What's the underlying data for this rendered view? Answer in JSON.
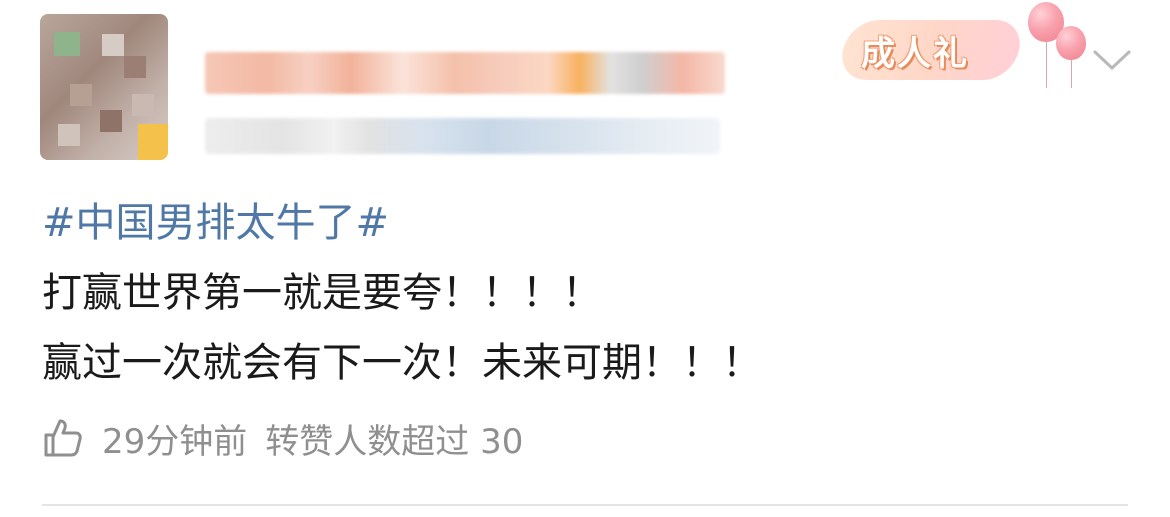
{
  "badge": {
    "label": "成人礼",
    "colors": {
      "background": "#ffd7c8",
      "text_outline": "#e88b5b",
      "balloon": "#f9a1ad"
    }
  },
  "post": {
    "hashtag": "#中国男排太牛了#",
    "lines": [
      "打赢世界第一就是要夸！！！！",
      "赢过一次就会有下一次！未来可期！！！"
    ],
    "time": "29分钟前",
    "repost_info": "转赞人数超过 30"
  },
  "icons": {
    "menu": "chevron-down-icon",
    "like": "thumbs-up-icon"
  },
  "colors": {
    "hashtag": "#4f78a6",
    "text": "#1a1a1a",
    "meta": "#8f8f8f",
    "divider": "#e4e4e4"
  }
}
